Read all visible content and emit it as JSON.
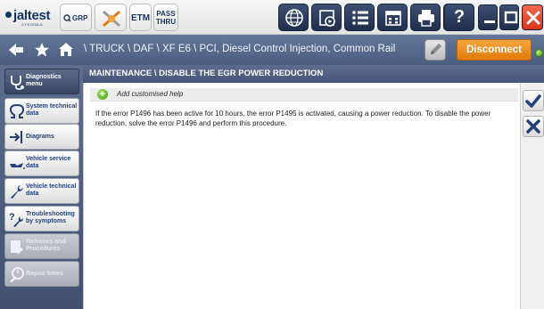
{
  "toolbar": {
    "logo": "jaltest",
    "logo_sub": "CYSOINLA",
    "grp_label": "GRP",
    "etm_label": "ETM",
    "pass_thru_line1": "PASS",
    "pass_thru_line2": "THRU",
    "help_label": "?",
    "colors": {
      "dark_button": "#2a3a5c",
      "close_button": "#e8432c"
    },
    "icons": [
      "diagnostic-tools-icon",
      "globe-icon",
      "media-icon",
      "list-icon",
      "calendar-icon",
      "print-icon",
      "camera-icon",
      "help-icon",
      "minimize-icon",
      "maximize-icon",
      "close-icon"
    ]
  },
  "navbar": {
    "breadcrumb": "\\ TRUCK \\ DAF \\ XF E6 \\ PCI, Diesel Control Injection, Common Rail",
    "disconnect_label": "Disconnect",
    "colors": {
      "disconnect": "#ef8c1e",
      "status": "#5fb81b"
    }
  },
  "sidebar": {
    "items": [
      {
        "label": "Diagnostics menu",
        "state": "active",
        "icon": "stethoscope-icon"
      },
      {
        "label": "System technical data",
        "state": "normal",
        "icon": "ohm-icon"
      },
      {
        "label": "Diagrams",
        "state": "normal",
        "icon": "diagram-icon"
      },
      {
        "label": "Vehicle service data",
        "state": "normal",
        "icon": "oil-can-icon"
      },
      {
        "label": "Vehicle technical data",
        "state": "normal",
        "icon": "wrench-icon"
      },
      {
        "label": "Troubleshooting by symptoms",
        "state": "normal",
        "icon": "troubleshooting-icon"
      },
      {
        "label": "Releases and Procedures",
        "state": "disabled",
        "icon": "procedures-icon"
      },
      {
        "label": "Repair times",
        "state": "disabled",
        "icon": "repair-times-icon"
      }
    ]
  },
  "main": {
    "title": "MAINTENANCE \\ DISABLE THE EGR POWER REDUCTION",
    "add_help_label": "Add customised help",
    "body": "If the error P1496 has been active for 10 hours, the error P1495 is activated, causing a power reduction. To disable the power reduction, solve the error P1496 and perform this procedure.",
    "actions": [
      "confirm-icon",
      "cancel-icon"
    ]
  }
}
